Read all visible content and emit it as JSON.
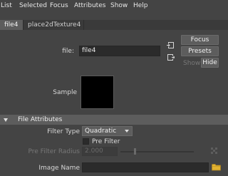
{
  "menu": [
    "List",
    "Selected",
    "Focus",
    "Attributes",
    "Show",
    "Help"
  ],
  "tabs": [
    "file4",
    "place2dTexture4"
  ],
  "file_field": {
    "label": "file:",
    "value": "file4"
  },
  "buttons": {
    "focus": "Focus",
    "presets": "Presets",
    "show": "Show",
    "hide": "Hide"
  },
  "sample_label": "Sample",
  "section": {
    "title": "File Attributes"
  },
  "filter_type": {
    "label": "Filter Type",
    "value": "Quadratic"
  },
  "pre_filter": {
    "label": "Pre Filter",
    "checked": false
  },
  "pre_filter_radius": {
    "label": "Pre Filter Radius",
    "value": "2.000"
  },
  "image_name": {
    "label": "Image Name",
    "value": ""
  },
  "colors": {
    "background": "#444444",
    "button": "#5d5d5d",
    "field": "#2b2b2b",
    "folder": "#e3b332"
  }
}
